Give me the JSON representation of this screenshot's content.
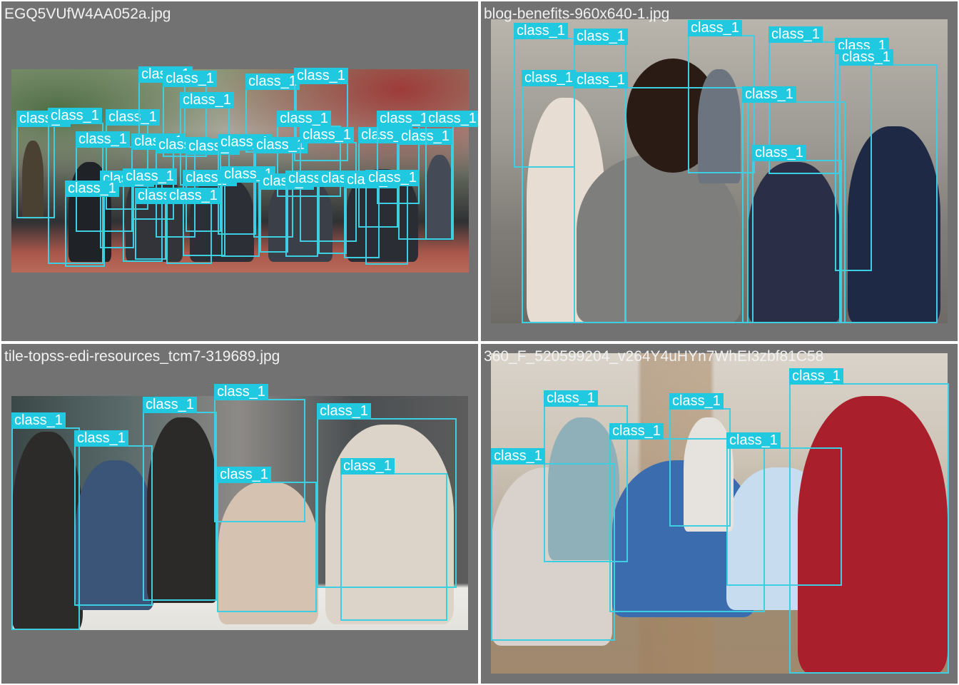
{
  "label_color": "#21c9e0",
  "box_color": "#3dcfe1",
  "panel_bg": "#727272",
  "panels": [
    {
      "title": "EGQ5VUfW4AA052a.jpg",
      "photo_palette": [
        "#6f8a62",
        "#9b4b45",
        "#b7b2a4",
        "#8e5a4e"
      ],
      "boxes": [
        {
          "label": "class_1"
        },
        {
          "label": "class_1"
        },
        {
          "label": "class_1"
        },
        {
          "label": "class_1"
        },
        {
          "label": "class_1"
        },
        {
          "label": "class_1"
        },
        {
          "label": "class_1"
        },
        {
          "label": "class_1"
        },
        {
          "label": "class_1"
        },
        {
          "label": "class_1"
        },
        {
          "label": "class_1"
        },
        {
          "label": "class_1"
        },
        {
          "label": "class_1"
        },
        {
          "label": "class_1"
        },
        {
          "label": "class_1"
        },
        {
          "label": "class_1"
        },
        {
          "label": "class_1"
        },
        {
          "label": "class_1"
        },
        {
          "label": "class_1"
        },
        {
          "label": "class_1"
        },
        {
          "label": "class_1"
        },
        {
          "label": "class_1"
        },
        {
          "label": "class_1"
        },
        {
          "label": "class_1"
        },
        {
          "label": "class_1"
        },
        {
          "label": "class_1"
        },
        {
          "label": "class_1"
        },
        {
          "label": "class_1"
        },
        {
          "label": "class_1"
        },
        {
          "label": "class_1"
        },
        {
          "label": "class_1"
        },
        {
          "label": "class_1"
        }
      ]
    },
    {
      "title": "blog-benefits-960x640-1.jpg",
      "photo_palette": [
        "#8f8f8a",
        "#cfcfcf",
        "#6d6d6d",
        "#3a4f7a"
      ],
      "boxes": [
        {
          "label": "class_1"
        },
        {
          "label": "class_1"
        },
        {
          "label": "class_1"
        },
        {
          "label": "class_1"
        },
        {
          "label": "class_1"
        },
        {
          "label": "class_1"
        },
        {
          "label": "class_1"
        },
        {
          "label": "class_1"
        },
        {
          "label": "class_1"
        },
        {
          "label": "class_1"
        }
      ]
    },
    {
      "title": "tile-topss-edi-resources_tcm7-319689.jpg",
      "photo_palette": [
        "#2f3a3a",
        "#b9a28a",
        "#e9e4dc",
        "#3b3b3b"
      ],
      "boxes": [
        {
          "label": "class_1"
        },
        {
          "label": "class_1"
        },
        {
          "label": "class_1"
        },
        {
          "label": "class_1"
        },
        {
          "label": "class_1"
        },
        {
          "label": "class_1"
        },
        {
          "label": "class_1"
        }
      ]
    },
    {
      "title": "360_F_520599204_v264Y4uHYn7WhEI3zbf81C58",
      "photo_palette": [
        "#d8d2c8",
        "#a4896b",
        "#3e6fb0",
        "#b3202c"
      ],
      "boxes": [
        {
          "label": "class_1"
        },
        {
          "label": "class_1"
        },
        {
          "label": "class_1"
        },
        {
          "label": "class_1"
        },
        {
          "label": "class_1"
        },
        {
          "label": "class_1"
        },
        {
          "label": "class_1"
        }
      ]
    }
  ]
}
